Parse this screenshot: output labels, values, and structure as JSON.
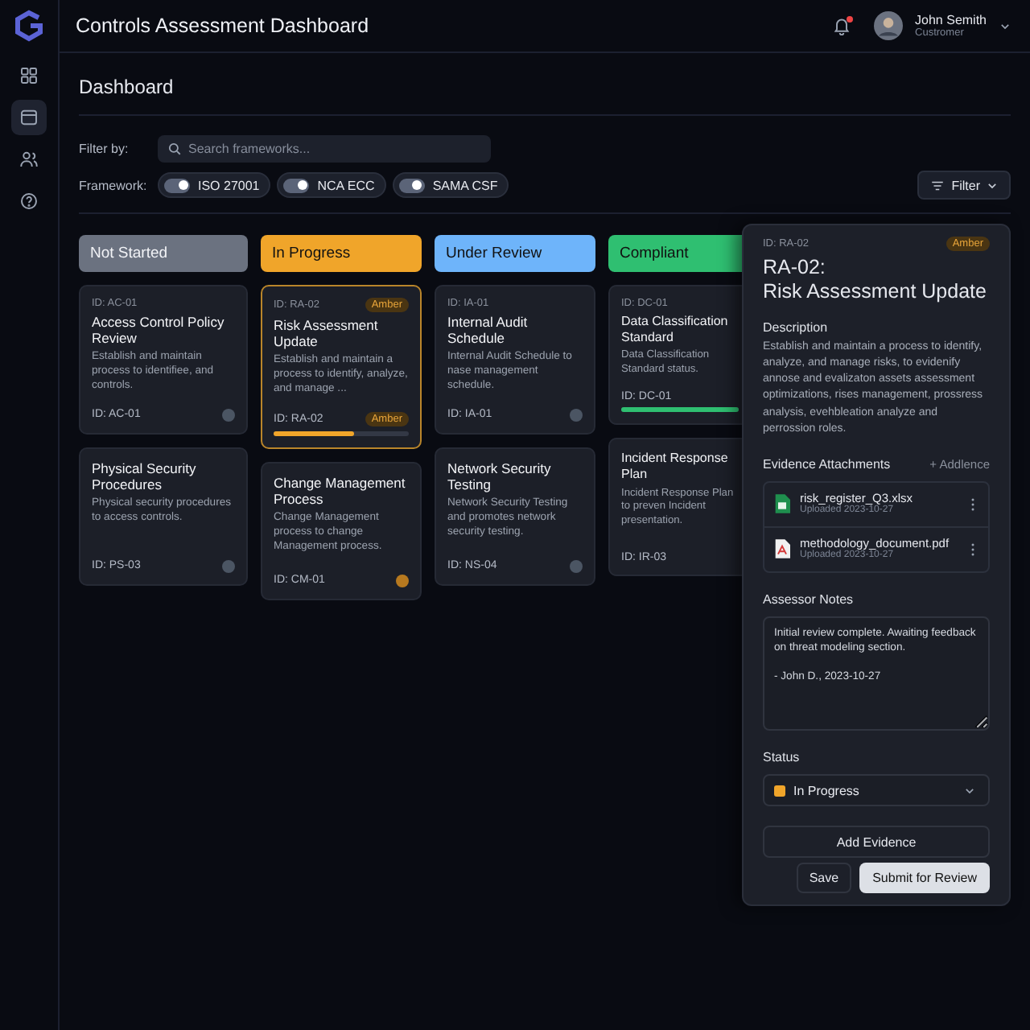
{
  "app": {
    "title": "Controls Assessment Dashboard"
  },
  "sidebar": {
    "items": [
      {
        "selected": false
      },
      {
        "selected": true
      },
      {
        "selected": false
      },
      {
        "selected": false
      }
    ]
  },
  "user": {
    "name": "John Semith",
    "role": "Custromer",
    "notification": true
  },
  "page_title": "Dashboard",
  "filter": {
    "label": "Filter by:",
    "placeholder": "Search frameworks...",
    "framework_label": "Framework:",
    "button": "Filter"
  },
  "frameworks": [
    {
      "label": "ISO 27001",
      "on": true
    },
    {
      "label": "NCA ECC",
      "on": true
    },
    {
      "label": "SAMA CSF",
      "on": true
    }
  ],
  "columns": [
    {
      "title": "Not Started",
      "color": "#6b7280",
      "cards": [
        {
          "id_top": "ID: AC-01",
          "title": "Access Control Policy Review",
          "description": "Establish and maintain process to identifiee, and controls.",
          "id": "ID: AC-01",
          "selected": false,
          "color": "#4b5563"
        },
        {
          "title": "Physical Security Procedures",
          "description": "Physical security procedures to access controls.",
          "id": "ID: PS-03",
          "selected": false,
          "color": "#4b5563"
        }
      ]
    },
    {
      "title": "In Progress",
      "color": "#f0a52a",
      "cards": [
        {
          "id_top": "ID: RA-02",
          "badge": "Amber",
          "title": "Risk Assessment Update",
          "description": "Establish and maintain a process to identify, analyze, and manage ...",
          "id": "ID: RA-02",
          "badge_bottom": "Amber",
          "level": 0.6,
          "selected": true
        },
        {
          "title": "Change Management Process",
          "description": "Change Management process to change Management process.",
          "id": "ID: CM-01",
          "selected": false,
          "color": "#b7791f"
        }
      ]
    },
    {
      "title": "Under Review",
      "color": "#6eb4fa",
      "cards": [
        {
          "id_top": "ID: IA-01",
          "title": "Internal Audit Schedule",
          "description": "Internal Audit Schedule to nase management schedule.",
          "id": "ID: IA-01",
          "selected": false,
          "color": "#4b5563"
        },
        {
          "title": "Network Security Testing",
          "description": "Network Security Testing and promotes network security testing.",
          "id": "ID: NS-04",
          "selected": false,
          "color": "#4b5563"
        }
      ]
    },
    {
      "title": "Compliant",
      "color": "#2fbf71",
      "cards": [
        {
          "id_top": "ID: DC-01",
          "title": "Data Classification Standard",
          "description": "Data Classification Standard status.",
          "id": "ID: DC-01",
          "level": 1,
          "selected": false
        },
        {
          "title": "Incident Response Plan",
          "description": "Incident Response Plan to preven Incident presentation.",
          "id": "ID: IR-03",
          "selected": false
        }
      ]
    }
  ],
  "panel": {
    "id": "ID: RA-02",
    "badge": "Amber",
    "title": "RA-02:\nRisk Assessment Update",
    "description_label": "Description",
    "description": "Establish and maintain a process to identify, analyze, and manage risks, to evidenify annose and evalizaton assets assessment optimizations, rises management, prossress analysis, evehbleation analyze and perrossion roles.",
    "attachments_label": "Evidence Attachments",
    "add_label": "+ Addlence",
    "attachments": [
      {
        "kind": "sheet",
        "name": "risk_register_Q3.xlsx",
        "date": "Uploaded 2023-10-27"
      },
      {
        "kind": "pdf",
        "name": "methodology_document.pdf",
        "date": "Uploaded 2023-10-27"
      }
    ],
    "notes_label": "Assessor Notes",
    "notes": "Initial review complete. Awaiting feedback on threat modeling section.\n\n- John D., 2023-10-27",
    "status_label": "Status",
    "status": "In Progress",
    "add_evidence": "Add Evidence",
    "save": "Save",
    "submit": "Submit for Review"
  }
}
